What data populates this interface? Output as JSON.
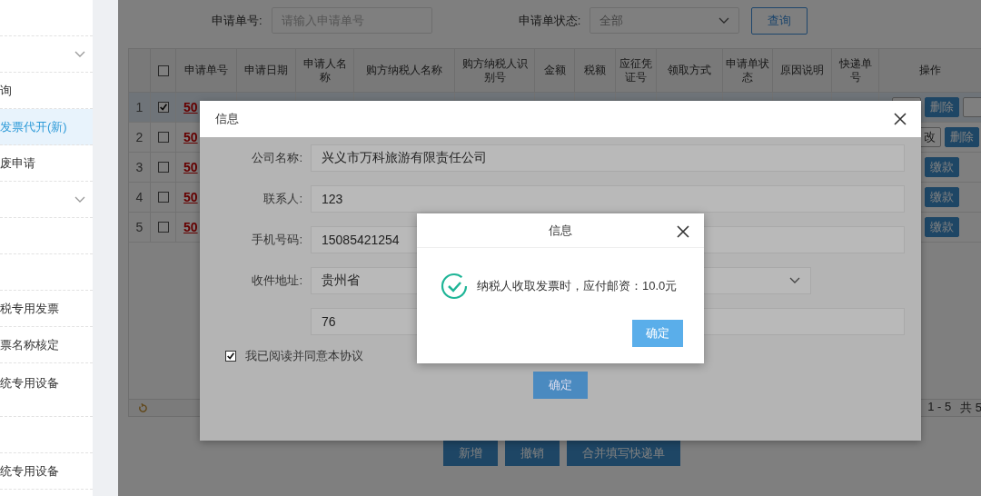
{
  "sidebar": {
    "items": [
      {
        "kind": "link",
        "selected": false
      },
      {
        "kind": "group",
        "selected": false
      },
      {
        "kind": "link",
        "label": "询",
        "selected": false
      },
      {
        "kind": "link",
        "label": "发票代开(新)",
        "selected": true
      },
      {
        "kind": "link",
        "label": "废申请",
        "selected": false
      },
      {
        "kind": "group",
        "selected": false
      },
      {
        "kind": "link",
        "selected": false
      },
      {
        "kind": "link",
        "selected": false
      },
      {
        "kind": "link",
        "label": "税专用发票",
        "selected": false
      },
      {
        "kind": "link",
        "label": "票名称核定",
        "selected": false
      },
      {
        "kind": "tall",
        "label": "统专用设备",
        "selected": false
      },
      {
        "kind": "link",
        "selected": false
      },
      {
        "kind": "link",
        "label": "统专用设备",
        "selected": false
      }
    ]
  },
  "search": {
    "number": {
      "label": "申请单号:",
      "placeholder": "请输入申请单号"
    },
    "status": {
      "label": "申请单状态:",
      "value": "全部"
    },
    "button": "查询"
  },
  "table": {
    "all_checked": false,
    "columns": [
      "申请单号",
      "申请日期",
      "申请人名称",
      "购方纳税人名称",
      "购方纳税人识别号",
      "金额",
      "税额",
      "应征凭证号",
      "领取方式",
      "申请单状态",
      "原因说明",
      "快递单号",
      "操作"
    ],
    "rows": [
      {
        "index": "1",
        "checked": true,
        "selected": true,
        "number": "50",
        "actions": [
          {
            "kind": "default"
          },
          {
            "kind": "primary",
            "label": "删除"
          },
          {
            "kind": "default"
          }
        ]
      },
      {
        "index": "2",
        "checked": false,
        "selected": false,
        "number": "50",
        "actions": [
          {
            "kind": "default",
            "label": "改"
          },
          {
            "kind": "primary",
            "label": "删除"
          }
        ]
      },
      {
        "index": "3",
        "checked": false,
        "selected": false,
        "number": "50",
        "actions": [
          {
            "kind": "primary",
            "label": "缴款"
          }
        ]
      },
      {
        "index": "4",
        "checked": false,
        "selected": false,
        "number": "50",
        "actions": [
          {
            "kind": "primary",
            "label": "缴款"
          }
        ]
      },
      {
        "index": "5",
        "checked": false,
        "selected": false,
        "number": "50",
        "actions": [
          {
            "kind": "primary",
            "label": "缴款"
          }
        ]
      }
    ],
    "pagination": {
      "range": "1 - 5",
      "total": "共 5"
    }
  },
  "buttons": [
    "新增",
    "撤销",
    "合并填写快递单"
  ],
  "dialog": {
    "title": "信息",
    "fields": [
      {
        "kind": "input",
        "label": "公司名称:",
        "value": "兴义市万科旅游有限责任公司"
      },
      {
        "kind": "input",
        "label": "联系人:",
        "value": "123"
      },
      {
        "kind": "input",
        "label": "手机号码:",
        "value": "15085421254"
      },
      {
        "kind": "select",
        "label": "收件地址:",
        "value": "贵州省"
      },
      {
        "kind": "input",
        "value": "76"
      }
    ],
    "agree": {
      "label": "我已阅读并同意本协议",
      "checked": true
    },
    "button": "确定"
  },
  "alert": {
    "title": "信息",
    "message": "纳税人收取发票时，应付邮资：10.0元",
    "button": "确定"
  }
}
